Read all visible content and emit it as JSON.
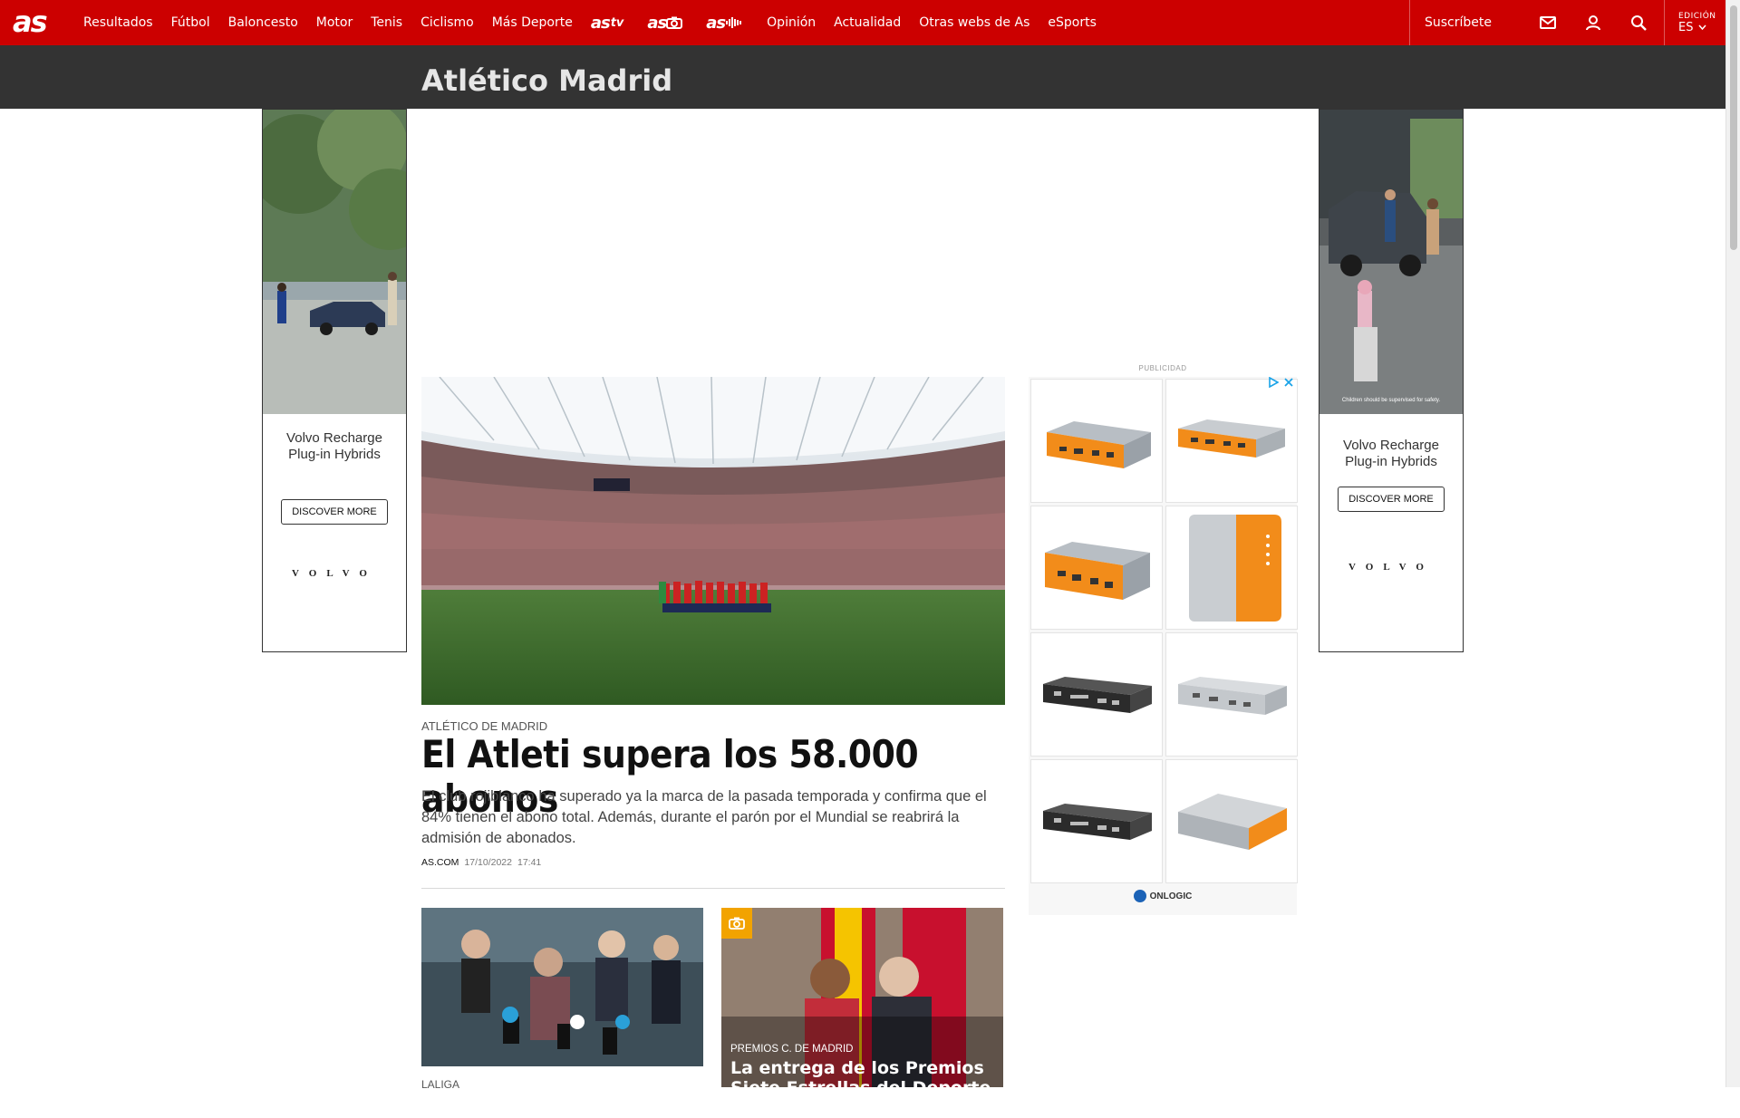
{
  "nav": {
    "logo": "as",
    "items": [
      "Resultados",
      "Fútbol",
      "Baloncesto",
      "Motor",
      "Tenis",
      "Ciclismo",
      "Más Deporte"
    ],
    "brands": [
      {
        "main": "as",
        "suffix": "tv"
      },
      {
        "main": "as",
        "suffix": "📷"
      },
      {
        "main": "as",
        "suffix": "🎙"
      }
    ],
    "items2": [
      "Opinión",
      "Actualidad",
      "Otras webs de As",
      "eSports"
    ],
    "subscribe": "Suscríbete",
    "edition_label": "EDICIÓN",
    "edition_value": "ES",
    "icons": [
      "mail-icon",
      "user-icon",
      "search-icon"
    ],
    "color": "#cc0000"
  },
  "section": {
    "title": "Atlético Madrid"
  },
  "side_ads": {
    "left": {
      "text_line1": "Volvo Recharge",
      "text_line2": "Plug-in Hybrids",
      "button": "DISCOVER MORE",
      "brand": "VOLVO"
    },
    "right": {
      "text_line1": "Volvo Recharge",
      "text_line2": "Plug-in Hybrids",
      "button": "DISCOVER MORE",
      "brand": "VOLVO",
      "disclaimer": "Children should be supervised for safety."
    }
  },
  "main_article": {
    "kicker": "ATLÉTICO DE MADRID",
    "headline": "El Atleti supera los 58.000 abonos",
    "summary": "El club rojiblanco ha superado ya la marca de la pasada temporada y confirma que el 84% tienen el abono total. Además, durante el parón por el Mundial se reabrirá la admisión de abonados.",
    "author": "AS.COM",
    "date": "17/10/2022",
    "time": "17:41"
  },
  "cards": [
    {
      "kicker": "LALIGA"
    },
    {
      "kicker": "PREMIOS C. DE MADRID",
      "title": "La entrega de los Premios Siete Estrellas del Deporte de la",
      "badge": "camera-icon"
    }
  ],
  "right_ad": {
    "label": "PUBLICIDAD",
    "brand": "ONLOGIC",
    "products": [
      "orange-mini-pc",
      "orange-mini-pc",
      "orange-mini-pc",
      "orange-tablet-case",
      "rack-server-dark",
      "rack-server-silver",
      "rack-server-dark",
      "orange-box-pc"
    ]
  }
}
